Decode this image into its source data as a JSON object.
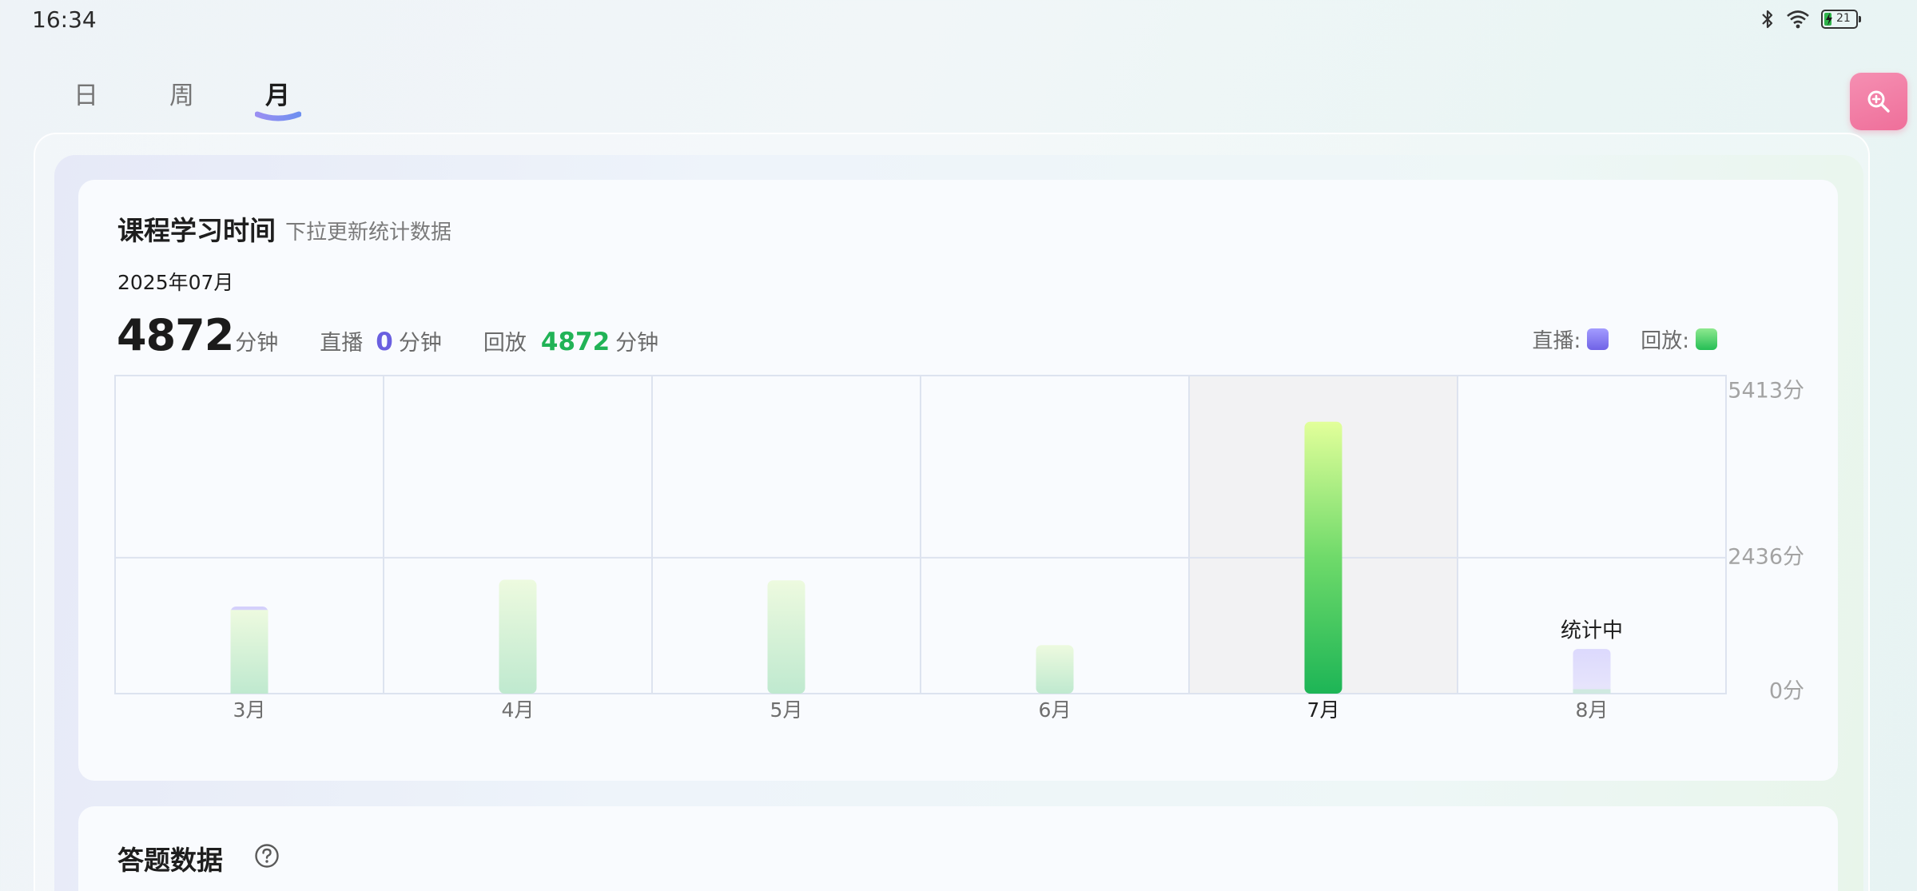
{
  "status_bar": {
    "time": "16:34",
    "battery": "21",
    "icons": [
      "bluetooth-icon",
      "wifi-icon",
      "battery-icon"
    ]
  },
  "tabs": [
    {
      "label": "日",
      "active": false
    },
    {
      "label": "周",
      "active": false
    },
    {
      "label": "月",
      "active": true
    }
  ],
  "zoom_button": {
    "icon": "zoom-in-icon",
    "color": "#f07aa3"
  },
  "study_card": {
    "title": "课程学习时间",
    "subtitle": "下拉更新统计数据",
    "date": "2025年07月",
    "total_value": "4872",
    "total_unit": "分钟",
    "live_label": "直播",
    "live_value": "0",
    "live_unit": "分钟",
    "replay_label": "回放",
    "replay_value": "4872",
    "replay_unit": "分钟",
    "legend_live": "直播:",
    "legend_replay": "回放:",
    "colors": {
      "live": "#7a6ef0",
      "replay": "#22b455",
      "live_value": "#6a5fe0",
      "replay_value": "#21b356"
    }
  },
  "chart_data": {
    "type": "bar",
    "categories": [
      "3月",
      "4月",
      "5月",
      "6月",
      "7月",
      "8月"
    ],
    "series": [
      {
        "name": "直播",
        "values": [
          60,
          0,
          0,
          0,
          0,
          0
        ]
      },
      {
        "name": "回放",
        "values": [
          1500,
          2040,
          2030,
          870,
          4872,
          80
        ]
      }
    ],
    "y_ticks": [
      "0分",
      "2436分",
      "5413分"
    ],
    "y_tick_values": [
      0,
      2436,
      5413
    ],
    "ylim": [
      0,
      5413
    ],
    "selected_category": "7月",
    "pending_category": "8月",
    "pending_label": "统计中",
    "pending_value": 800,
    "grid": true
  },
  "answer_card": {
    "title": "答题数据",
    "help_icon": "help-icon"
  }
}
